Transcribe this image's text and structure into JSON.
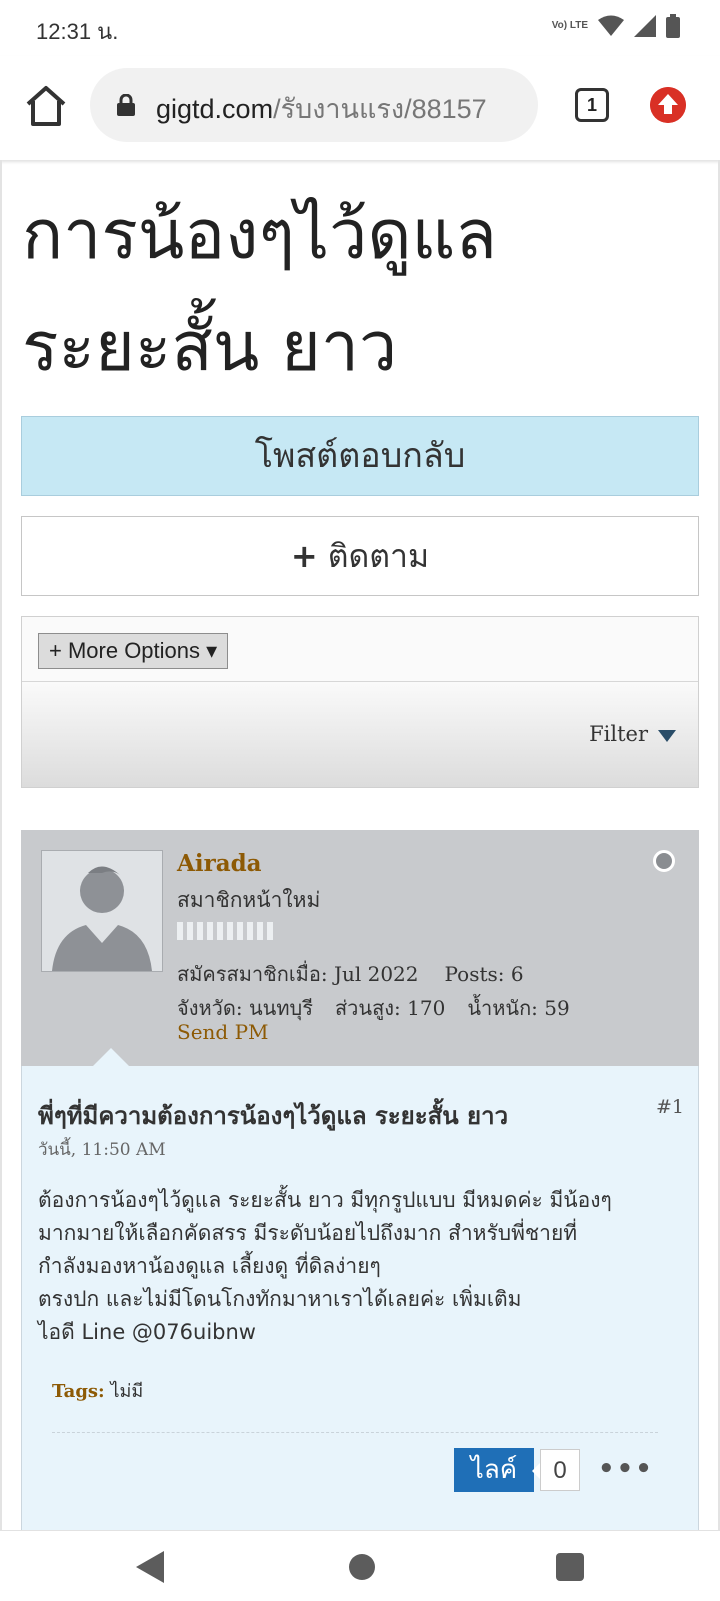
{
  "status_bar": {
    "time": "12:31 น.",
    "volte_label": "Vo) LTE"
  },
  "browser": {
    "url_host": "gigtd.com",
    "url_path": "/รับงานแรง/88157",
    "tab_count": "1"
  },
  "thread": {
    "title_line1": "การน้องๆไว้ดูแล",
    "title_line2": "ระยะสั้น ยาว",
    "reply_label": "โพสต์ตอบกลับ",
    "follow_plus": "+",
    "follow_label": "ติดตาม",
    "more_options_label": "+ More Options ▾",
    "filter_label": "Filter"
  },
  "post": {
    "username": "Airada",
    "user_title": "สมาชิกหน้าใหม่",
    "joined": "สมัครสมาชิกเมื่อ: Jul 2022",
    "posts": "Posts: 6",
    "province": "จังหวัด: นนทบุรี",
    "height": "ส่วนสูง: 170",
    "weight": "น้ำหนัก: 59",
    "send_pm": "Send PM",
    "title": "พี่ๆที่มีความต้องการน้องๆไว้ดูแล ระยะสั้น ยาว",
    "number": "#1",
    "date": "วันนี้, 11:50 AM",
    "body_lines": [
      "ต้องการน้องๆไว้ดูแล ระยะสั้น ยาว มีทุกรูปแบบ มีหมดค่ะ มีน้องๆ",
      "มากมายให้เลือกคัดสรร มีระดับน้อยไปถึงมาก สำหรับพี่ชายที่",
      "กำลังมองหาน้องดูแล เลี้ยงดู ที่ดิลง่ายๆ",
      "ตรงปก และไม่มีโดนโกงทักมาหาเราได้เลยค่ะ เพิ่มเติม",
      "ไอดี Line @076uibnw"
    ],
    "tags_label": "Tags:",
    "tags_value": "ไม่มี",
    "like_label": "ไลค์",
    "like_count": "0"
  }
}
